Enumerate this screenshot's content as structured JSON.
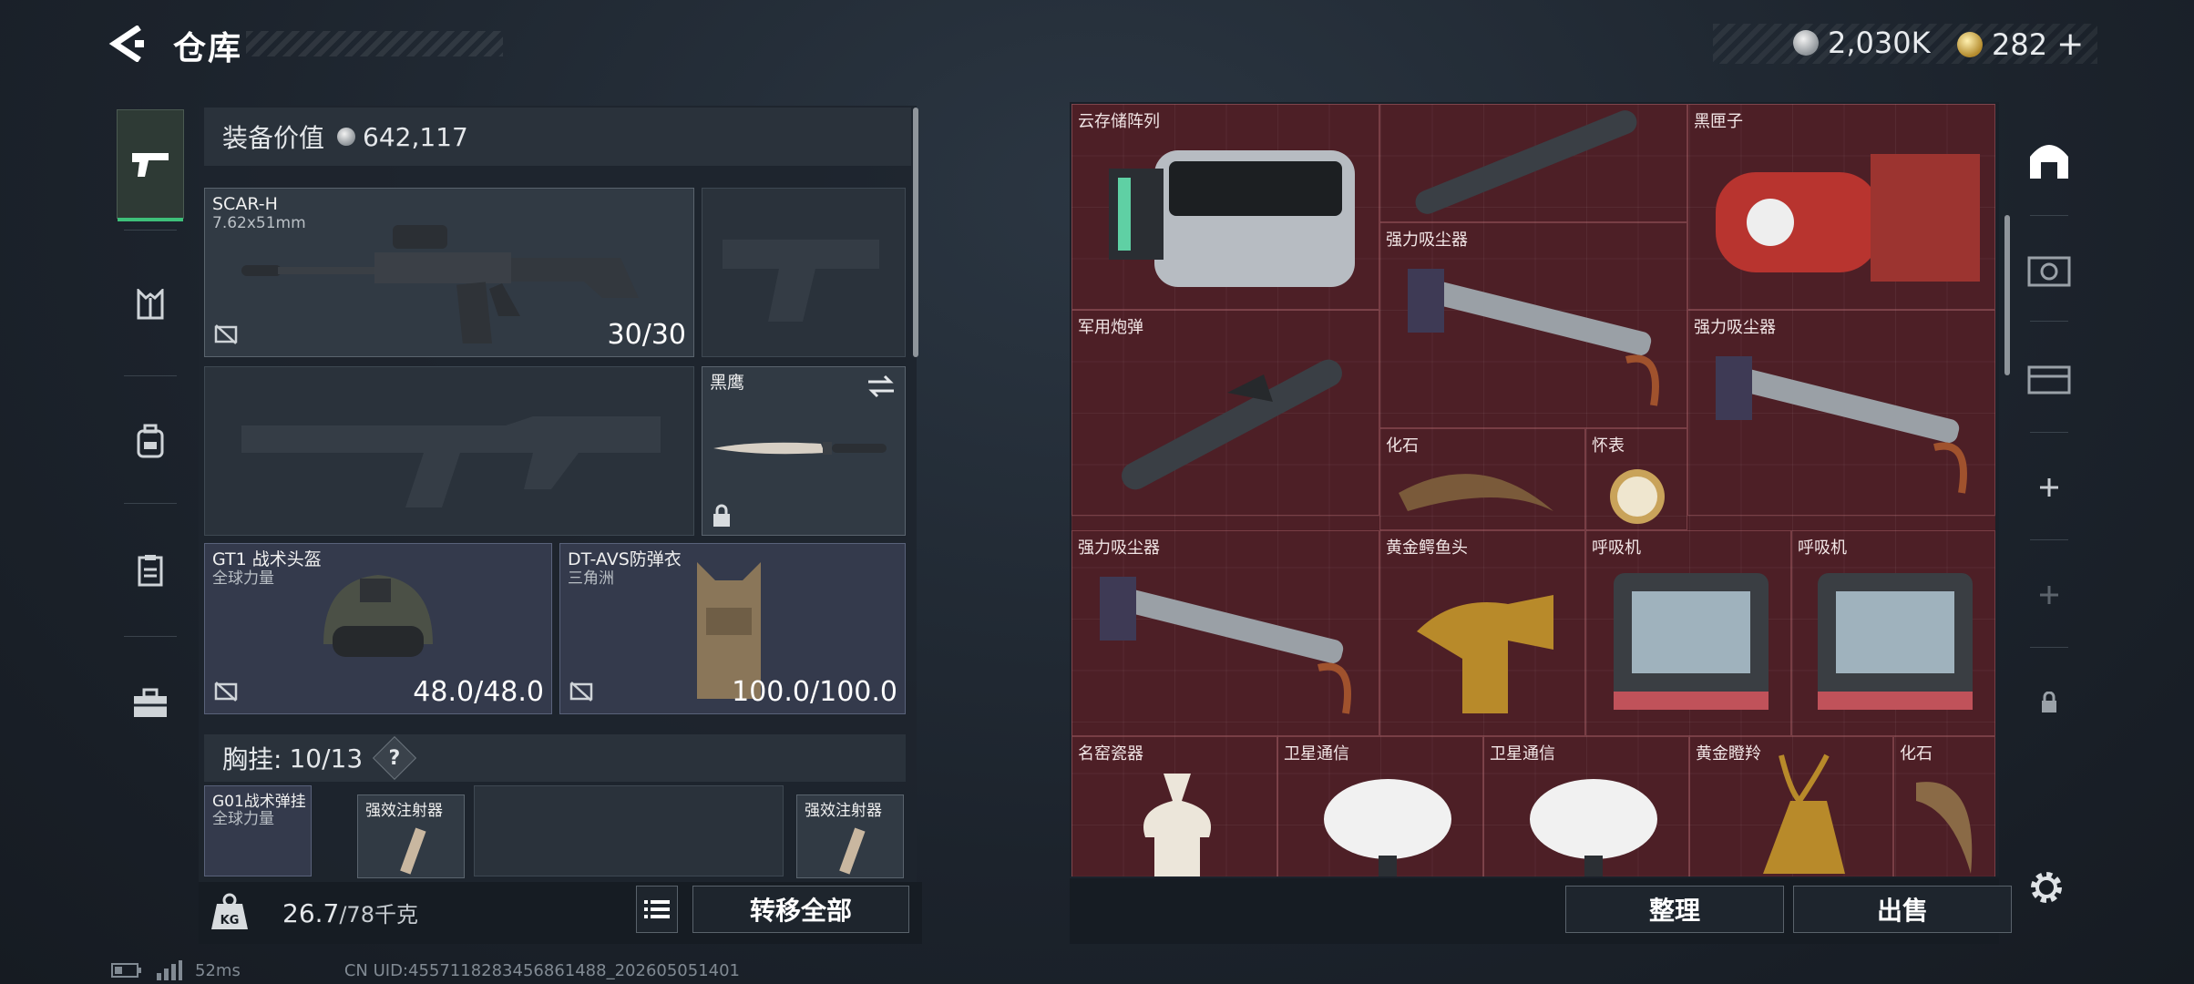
{
  "header": {
    "title": "仓库"
  },
  "currency": {
    "silver": "2,030K",
    "gold": "282"
  },
  "equipment": {
    "value_label": "装备价值",
    "value": "642,117",
    "primary_weapon": {
      "name": "SCAR-H",
      "ammo_type": "7.62x51mm",
      "ammo": "30/30"
    },
    "melee": {
      "name": "黑鹰"
    },
    "helmet": {
      "name": "GT1 战术头盔",
      "sub": "全球力量",
      "durability": "48.0/48.0"
    },
    "armor": {
      "name": "DT-AVS防弹衣",
      "sub": "三角洲",
      "durability": "100.0/100.0"
    },
    "chest_rig": {
      "label": "胸挂:",
      "count": "10/13",
      "help": "?",
      "item_name": "G01战术弹挂",
      "item_sub": "全球力量",
      "slot1": "强效注射器",
      "slot2": "强效注射器"
    }
  },
  "capacity": {
    "weight": "26.7",
    "max": "/78千克",
    "kg_icon": "KG"
  },
  "buttons": {
    "transfer_all": "转移全部",
    "organize": "整理",
    "sell": "出售"
  },
  "stash_items": [
    {
      "label": "云存储阵列"
    },
    {
      "label": ""
    },
    {
      "label": "黑匣子"
    },
    {
      "label": "强力吸尘器"
    },
    {
      "label": "军用炮弹"
    },
    {
      "label": "强力吸尘器"
    },
    {
      "label": "化石"
    },
    {
      "label": "怀表"
    },
    {
      "label": "强力吸尘器"
    },
    {
      "label": "黄金鳄鱼头"
    },
    {
      "label": "呼吸机"
    },
    {
      "label": "呼吸机"
    },
    {
      "label": "名窑瓷器"
    },
    {
      "label": "卫星通信"
    },
    {
      "label": "卫星通信"
    },
    {
      "label": "黄金瞪羚"
    },
    {
      "label": "化石"
    }
  ],
  "status": {
    "ping": "52ms",
    "uid": "CN UID:4557118283456861488_202605051401"
  },
  "colors": {
    "stash_bg": "#4d1f26",
    "active_tab": "#3ec07a"
  }
}
